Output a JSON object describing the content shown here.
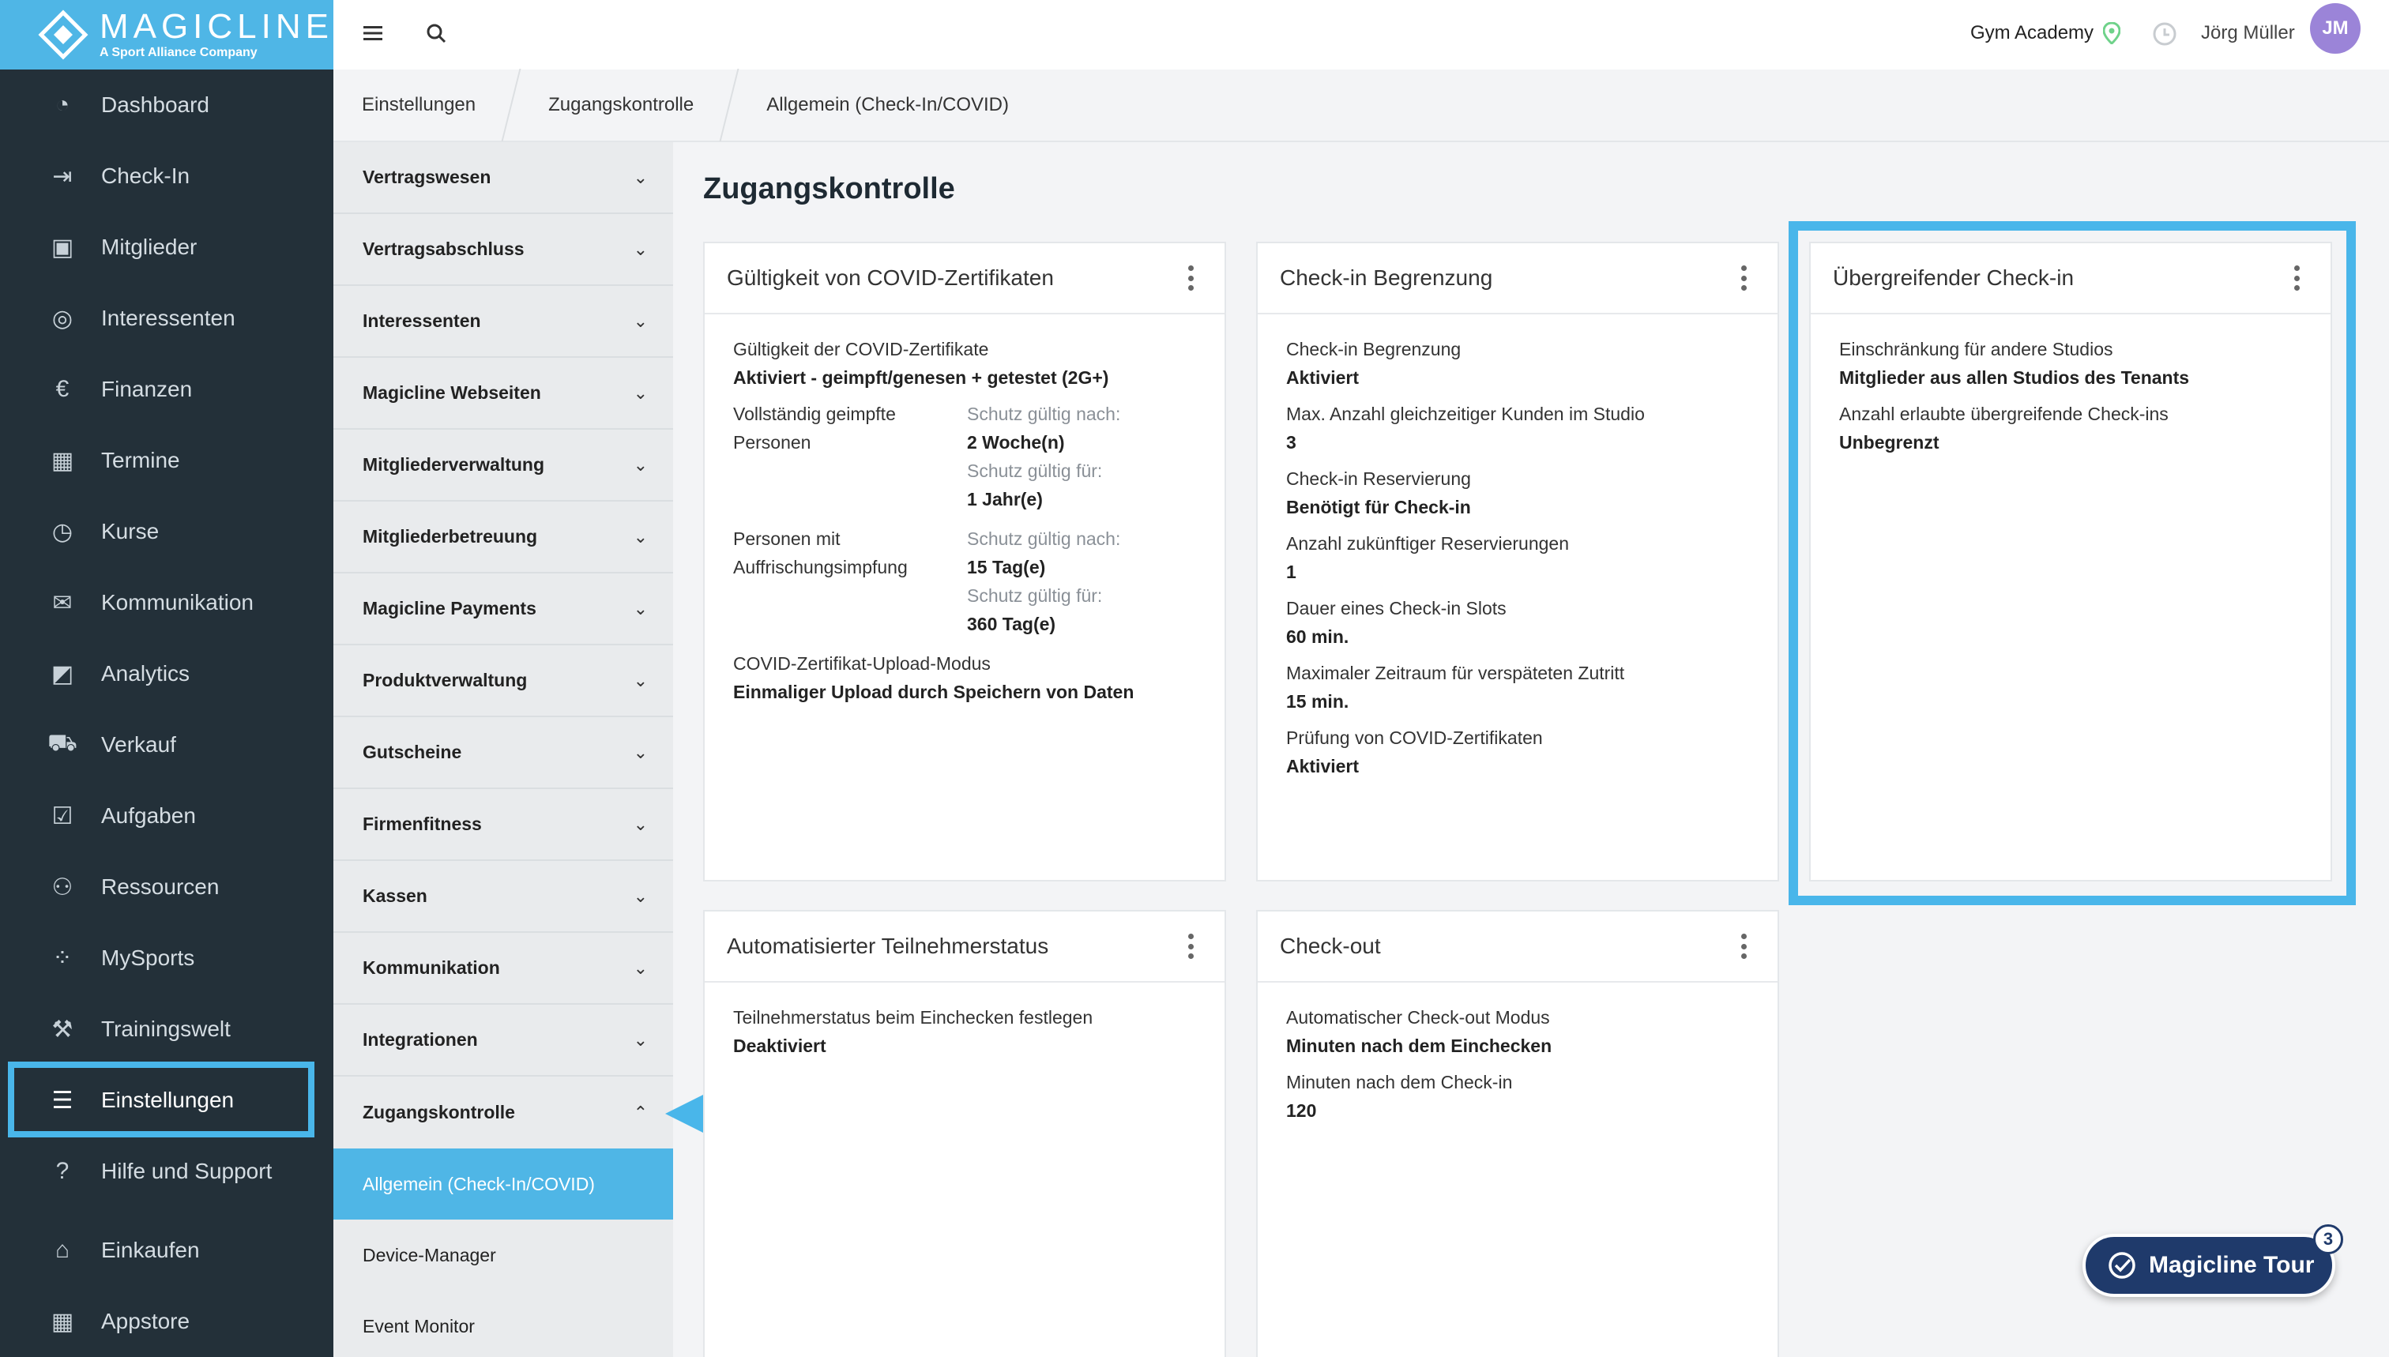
{
  "brand": {
    "title": "MAGICLINE",
    "subtitle": "A Sport Alliance Company"
  },
  "sidebar": {
    "items": [
      {
        "label": "Dashboard",
        "icon": "dashboard-icon"
      },
      {
        "label": "Check-In",
        "icon": "check-in-icon"
      },
      {
        "label": "Mitglieder",
        "icon": "members-icon"
      },
      {
        "label": "Interessenten",
        "icon": "prospects-icon"
      },
      {
        "label": "Finanzen",
        "icon": "euro-icon"
      },
      {
        "label": "Termine",
        "icon": "calendar-icon"
      },
      {
        "label": "Kurse",
        "icon": "stopwatch-icon"
      },
      {
        "label": "Kommunikation",
        "icon": "chat-icon"
      },
      {
        "label": "Analytics",
        "icon": "chart-icon"
      },
      {
        "label": "Verkauf",
        "icon": "cart-icon"
      },
      {
        "label": "Aufgaben",
        "icon": "checkbox-icon"
      },
      {
        "label": "Ressourcen",
        "icon": "group-icon"
      },
      {
        "label": "MySports",
        "icon": "dots-icon"
      },
      {
        "label": "Trainingswelt",
        "icon": "dumbbell-icon"
      },
      {
        "label": "Einstellungen",
        "icon": "sliders-icon",
        "active": true
      },
      {
        "label": "Hilfe und Support",
        "icon": "help-icon"
      },
      {
        "label": "Einkaufen",
        "icon": "shop-icon"
      },
      {
        "label": "Appstore",
        "icon": "apps-icon"
      }
    ]
  },
  "topbar": {
    "studio": "Gym Academy",
    "user": "Jörg Müller",
    "initials": "JM"
  },
  "breadcrumb": [
    "Einstellungen",
    "Zugangskontrolle",
    "Allgemein (Check-In/COVID)"
  ],
  "settings_menu": {
    "items": [
      "Vertragswesen",
      "Vertragsabschluss",
      "Interessenten",
      "Magicline Webseiten",
      "Mitgliederverwaltung",
      "Mitgliederbetreuung",
      "Magicline Payments",
      "Produktverwaltung",
      "Gutscheine",
      "Firmenfitness",
      "Kassen",
      "Kommunikation",
      "Integrationen"
    ],
    "expanded": "Zugangskontrolle",
    "sub_items": [
      "Allgemein (Check-In/COVID)",
      "Device-Manager",
      "Event Monitor"
    ],
    "active_sub": "Allgemein (Check-In/COVID)"
  },
  "main": {
    "title": "Zugangskontrolle",
    "covid": {
      "title": "Gültigkeit von COVID-Zertifikaten",
      "validity_label": "Gültigkeit der COVID-Zertifikate",
      "validity_value": "Aktiviert - geimpft/genesen + getestet (2G+)",
      "vacc_label": "Vollständig geimpfte Personen",
      "valid_after_label": "Schutz gültig nach:",
      "vacc_after": "2 Woche(n)",
      "valid_for_label": "Schutz gültig für:",
      "vacc_for": "1 Jahr(e)",
      "boost_label": "Personen mit Auffrischungsimpfung",
      "boost_after": "15 Tag(e)",
      "boost_for": "360 Tag(e)",
      "upload_label": "COVID-Zertifikat-Upload-Modus",
      "upload_value": "Einmaliger Upload durch Speichern von Daten"
    },
    "limit": {
      "title": "Check-in Begrenzung",
      "fields": [
        {
          "label": "Check-in Begrenzung",
          "value": "Aktiviert"
        },
        {
          "label": "Max. Anzahl gleichzeitiger Kunden im Studio",
          "value": "3"
        },
        {
          "label": "Check-in Reservierung",
          "value": "Benötigt für Check-in"
        },
        {
          "label": "Anzahl zukünftiger Reservierungen",
          "value": "1"
        },
        {
          "label": "Dauer eines Check-in Slots",
          "value": "60 min."
        },
        {
          "label": "Maximaler Zeitraum für verspäteten Zutritt",
          "value": "15 min."
        },
        {
          "label": "Prüfung von COVID-Zertifikaten",
          "value": "Aktiviert"
        }
      ]
    },
    "cross": {
      "title": "Übergreifender Check-in",
      "fields": [
        {
          "label": "Einschränkung für andere Studios",
          "value": "Mitglieder aus allen Studios des Tenants"
        },
        {
          "label": "Anzahl erlaubte übergreifende Check-ins",
          "value": "Unbegrenzt"
        }
      ]
    },
    "auto_status": {
      "title": "Automatisierter Teilnehmerstatus",
      "fields": [
        {
          "label": "Teilnehmerstatus beim Einchecken festlegen",
          "value": "Deaktiviert"
        }
      ]
    },
    "checkout": {
      "title": "Check-out",
      "fields": [
        {
          "label": "Automatischer Check-out Modus",
          "value": "Minuten nach dem Einchecken"
        },
        {
          "label": "Minuten nach dem Check-in",
          "value": "120"
        }
      ]
    }
  },
  "tour": {
    "label": "Magicline Tour",
    "badge": "3"
  },
  "colors": {
    "accent": "#4fb6e6",
    "sidebar": "#233039",
    "highlight": "#49b6ea",
    "tour": "#1f3a6b"
  }
}
